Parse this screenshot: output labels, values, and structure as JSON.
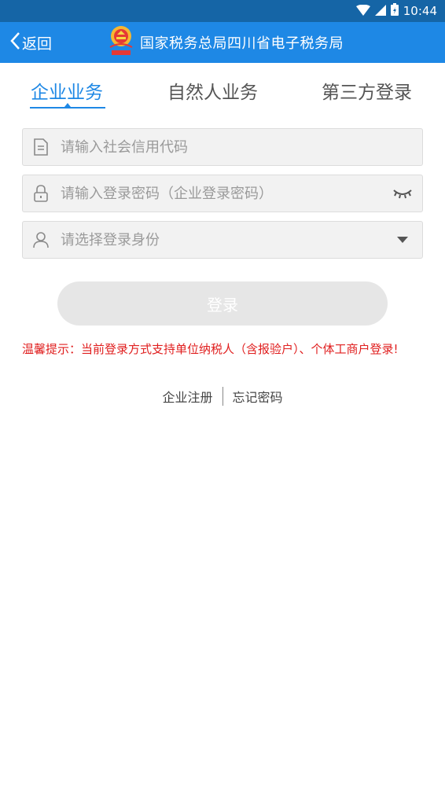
{
  "status_bar": {
    "time": "10:44"
  },
  "header": {
    "back_label": "返回",
    "title": "国家税务总局四川省电子税务局"
  },
  "tabs": [
    {
      "label": "企业业务",
      "active": true
    },
    {
      "label": "自然人业务",
      "active": false
    },
    {
      "label": "第三方登录",
      "active": false
    }
  ],
  "form": {
    "credit_code_placeholder": "请输入社会信用代码",
    "password_placeholder": "请输入登录密码（企业登录密码）",
    "identity_placeholder": "请选择登录身份",
    "login_label": "登录"
  },
  "notice": "温馨提示：当前登录方式支持单位纳税人（含报验户）、个体工商户登录!",
  "links": {
    "register": "企业注册",
    "forgot": "忘记密码"
  },
  "colors": {
    "primary": "#1e88e5",
    "status_bar": "#1565a6",
    "warning": "#e01e1e"
  }
}
